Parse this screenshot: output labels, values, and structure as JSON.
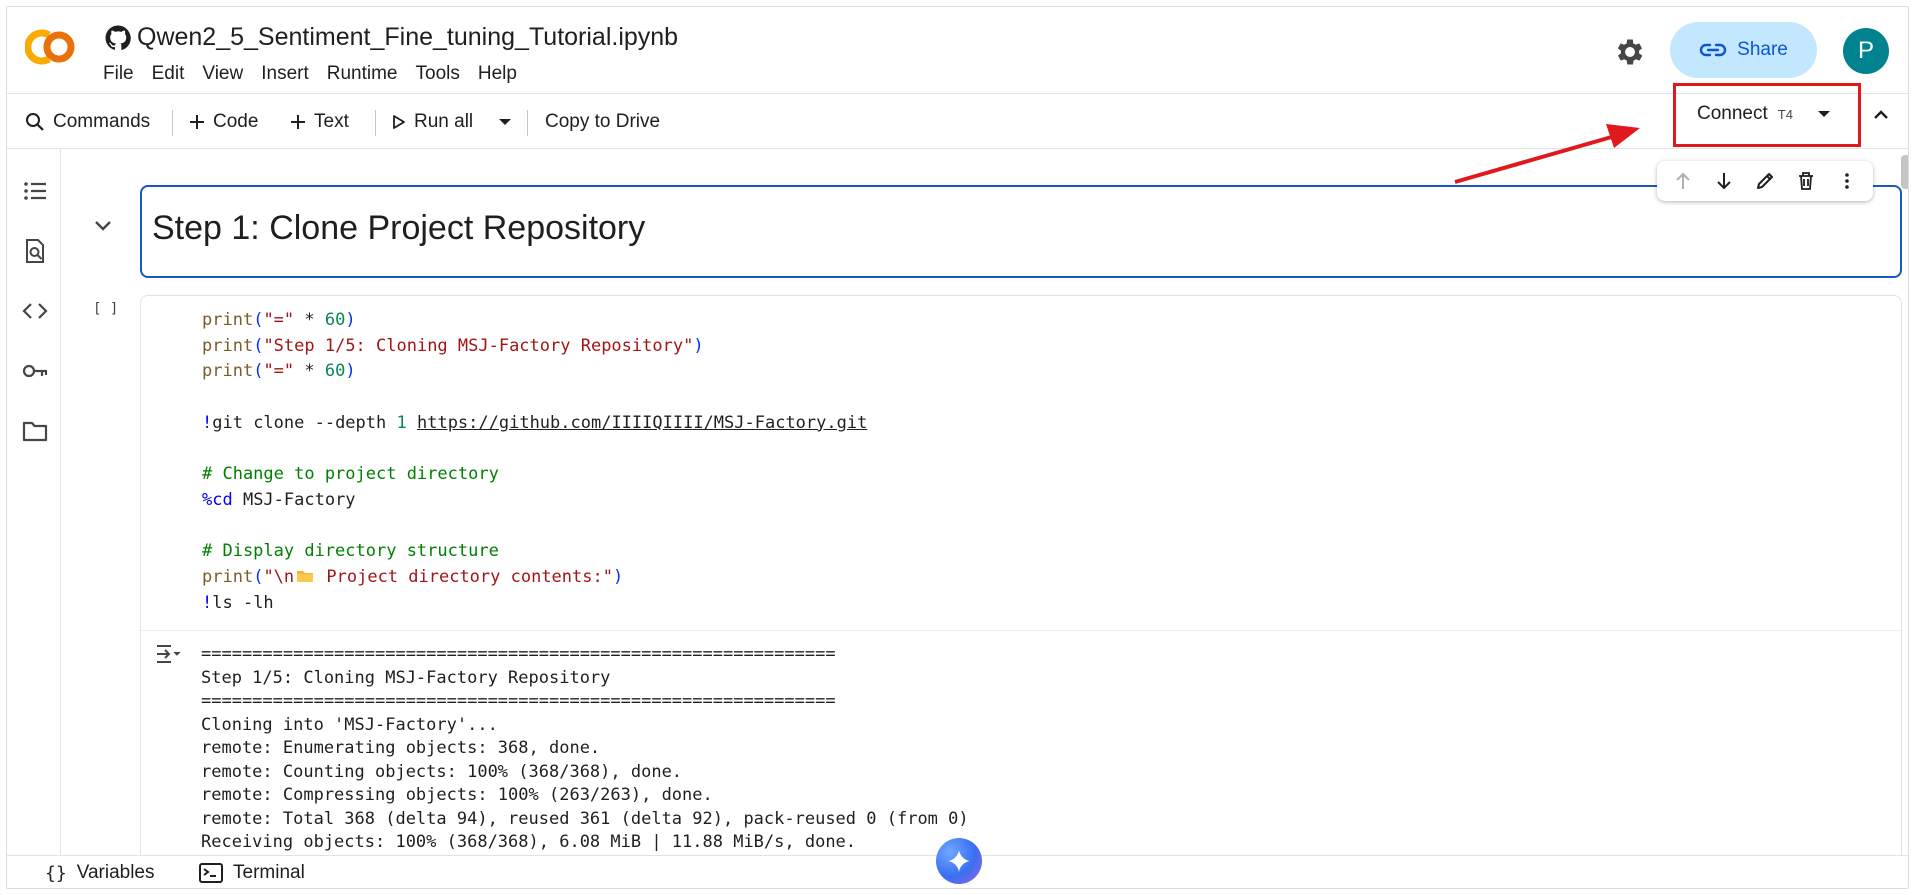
{
  "header": {
    "notebook_title": "Qwen2_5_Sentiment_Fine_tuning_Tutorial.ipynb",
    "menu": [
      "File",
      "Edit",
      "View",
      "Insert",
      "Runtime",
      "Tools",
      "Help"
    ],
    "share_label": "Share",
    "avatar_letter": "P"
  },
  "toolbar": {
    "commands_label": "Commands",
    "code_label": "Code",
    "text_label": "Text",
    "run_all_label": "Run all",
    "copy_label": "Copy to Drive",
    "connect_label": "Connect",
    "runtime_badge": "T4"
  },
  "cells": {
    "heading": "Step 1: Clone Project Repository",
    "run_status": "[ ]",
    "code_lines": {
      "l1_fn": "print",
      "l1_a": "(",
      "l1_str": "\"=\"",
      "l1_b": " * ",
      "l1_num": "60",
      "l1_c": ")",
      "l2_fn": "print",
      "l2_a": "(",
      "l2_str": "\"Step 1/5: Cloning MSJ-Factory Repository\"",
      "l2_c": ")",
      "l3_fn": "print",
      "l3_a": "(",
      "l3_str": "\"=\"",
      "l3_b": " * ",
      "l3_num": "60",
      "l3_c": ")",
      "l4_bang": "!",
      "l4_cmd": "git clone --depth ",
      "l4_num": "1",
      "l4_url": "https://github.com/IIIIQIIII/MSJ-Factory.git",
      "l5_comment": "# Change to project directory",
      "l6_magic": "%cd",
      "l6_rest": " MSJ-Factory",
      "l7_comment": "# Display directory structure",
      "l8_fn": "print",
      "l8_a": "(",
      "l8_str1": "\"\\n",
      "l8_str2": " Project directory contents:\"",
      "l8_c": ")",
      "l9_bang": "!",
      "l9_cmd": "ls -lh"
    },
    "output_lines": [
      "==============================================================",
      "Step 1/5: Cloning MSJ-Factory Repository",
      "==============================================================",
      "Cloning into 'MSJ-Factory'...",
      "remote: Enumerating objects: 368, done.",
      "remote: Counting objects: 100% (368/368), done.",
      "remote: Compressing objects: 100% (263/263), done.",
      "remote: Total 368 (delta 94), reused 361 (delta 92), pack-reused 0 (from 0)",
      "Receiving objects: 100% (368/368), 6.08 MiB | 11.88 MiB/s, done."
    ]
  },
  "bottom": {
    "variables_label": "Variables",
    "terminal_label": "Terminal"
  },
  "colors": {
    "accent": "#0b57d0",
    "share_bg": "#c2e7ff",
    "annotation_red": "#e0191d",
    "avatar_bg": "#00838f"
  }
}
